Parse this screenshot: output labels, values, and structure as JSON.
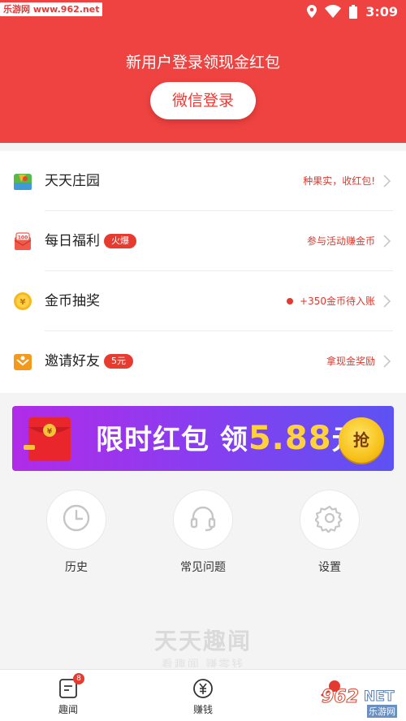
{
  "status_bar": {
    "watermark": "乐游网 www.962.net",
    "time": "3:09"
  },
  "header": {
    "prompt": "新用户登录领现金红包",
    "login_button": "微信登录"
  },
  "menu": [
    {
      "label": "天天庄园",
      "badge": "",
      "note": "种果实，收红包!",
      "icon": "farm-icon"
    },
    {
      "label": "每日福利",
      "badge": "火爆",
      "note": "参与活动赚金币",
      "icon": "gift-icon"
    },
    {
      "label": "金币抽奖",
      "badge": "",
      "note": "+350金币待入账",
      "icon": "coin-icon"
    },
    {
      "label": "邀请好友",
      "badge": "5元",
      "note": "拿现金奖励",
      "icon": "invite-icon"
    }
  ],
  "banner": {
    "text": "限时红包 领",
    "amount": "5.88",
    "unit": "元",
    "grab": "抢"
  },
  "shortcuts": [
    {
      "label": "历史",
      "icon": "clock-icon"
    },
    {
      "label": "常见问题",
      "icon": "headset-icon"
    },
    {
      "label": "设置",
      "icon": "gear-icon"
    }
  ],
  "footer": {
    "title": "天天趣闻",
    "subtitle": "看趣闻 赚零钱"
  },
  "tabs": [
    {
      "label": "趣闻",
      "count": "8",
      "icon": "news-icon"
    },
    {
      "label": "赚钱",
      "count": "",
      "icon": "yuan-icon"
    }
  ],
  "bottom_watermark": {
    "number": "962",
    "net": "NET",
    "site": "乐游网"
  },
  "colors": {
    "header_red": "#ee4341",
    "accent_red": "#e83b30",
    "banner_purple": "#8c3cf0",
    "banner_gold": "#ffd23b"
  }
}
